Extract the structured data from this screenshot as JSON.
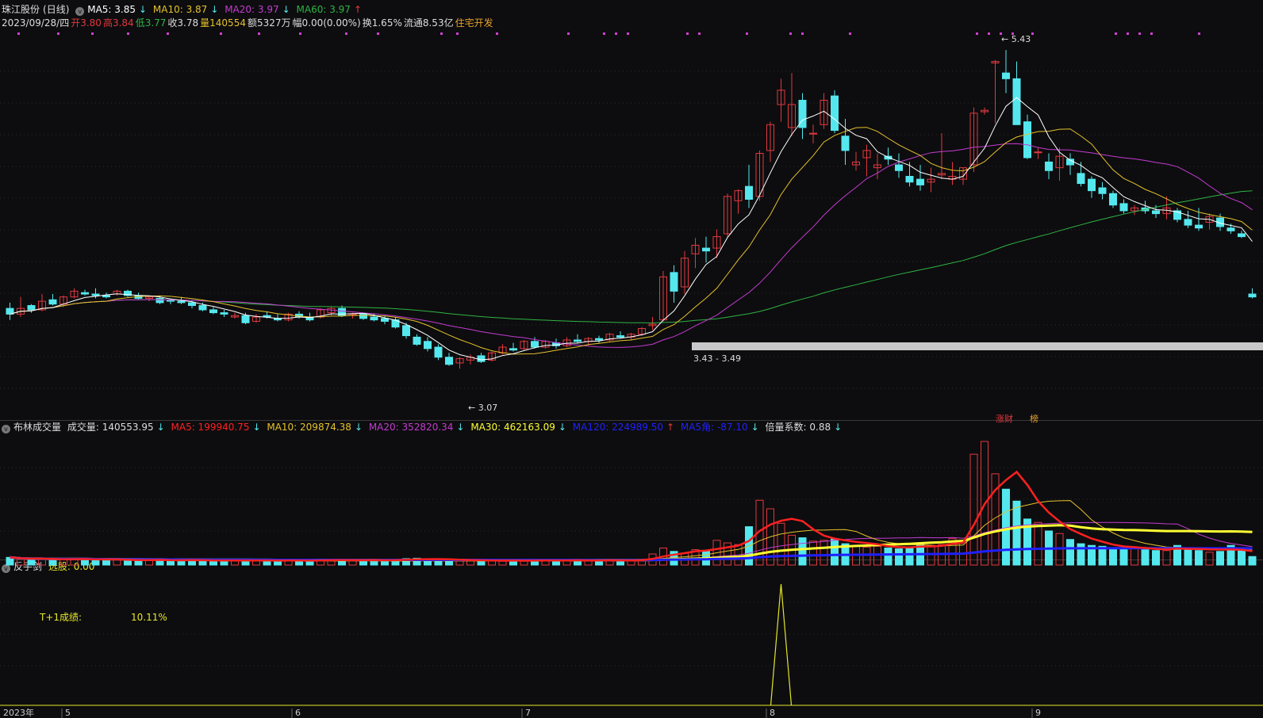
{
  "main": {
    "name": "珠江股份",
    "period": "(日线)",
    "ma5": "MA5: 3.85",
    "ma10": "MA10: 3.87",
    "ma20": "MA20: 3.97",
    "ma60": "MA60: 3.97",
    "info": {
      "date": "2023/09/28/四",
      "open": "开3.80",
      "high": "高3.84",
      "low": "低3.77",
      "close": "收3.78",
      "vol": "量140554",
      "amount": "额5327万",
      "range": "幅0.00(0.00%)",
      "turnover": "换1.65%",
      "float": "流通8.53亿",
      "industry": "住宅开发"
    },
    "labels": {
      "high": "5.43",
      "low": "3.07",
      "gap": "3.43 - 3.49"
    },
    "flags": {
      "zhangcai": "涨财",
      "bang": "榜"
    },
    "colors": {
      "up": "#e0393f",
      "down": "#54e8ee",
      "ma5": "#ffffff",
      "ma10": "#e5c12b",
      "ma20": "#c43bd0",
      "ma60": "#2fb344"
    }
  },
  "volume": {
    "name": "布林成交量",
    "vol": "成交量: 140553.95",
    "ma5": "MA5: 199940.75",
    "ma10": "MA10: 209874.38",
    "ma20": "MA20: 352820.34",
    "ma30": "MA30: 462163.09",
    "ma120": "MA120: 224989.50",
    "ma5jiao": "MA5角: -87.10",
    "factor": "倍量系数: 0.88"
  },
  "indicator": {
    "name": "反手剑",
    "pick": "选股: 0.00",
    "t1_label": "T+1成绩:",
    "t1_value": "10.11%"
  },
  "axis": {
    "year": "2023年",
    "months": [
      "5",
      "6",
      "7",
      "8",
      "9"
    ]
  },
  "chart_data": {
    "type": "candlestick",
    "title": "珠江股份 (日线)",
    "y_range": [
      2.95,
      5.6
    ],
    "candles": [
      [
        3.7,
        3.74,
        3.62,
        3.66
      ],
      [
        3.66,
        3.78,
        3.64,
        3.7
      ],
      [
        3.72,
        3.73,
        3.67,
        3.69
      ],
      [
        3.69,
        3.8,
        3.68,
        3.75
      ],
      [
        3.76,
        3.8,
        3.72,
        3.73
      ],
      [
        3.73,
        3.79,
        3.71,
        3.78
      ],
      [
        3.78,
        3.84,
        3.77,
        3.82
      ],
      [
        3.81,
        3.83,
        3.79,
        3.8
      ],
      [
        3.8,
        3.84,
        3.77,
        3.79
      ],
      [
        3.79,
        3.81,
        3.77,
        3.78
      ],
      [
        3.8,
        3.83,
        3.79,
        3.82
      ],
      [
        3.82,
        3.83,
        3.78,
        3.79
      ],
      [
        3.79,
        3.81,
        3.76,
        3.77
      ],
      [
        3.77,
        3.79,
        3.75,
        3.78
      ],
      [
        3.77,
        3.79,
        3.73,
        3.74
      ],
      [
        3.76,
        3.77,
        3.73,
        3.75
      ],
      [
        3.75,
        3.78,
        3.73,
        3.74
      ],
      [
        3.74,
        3.76,
        3.7,
        3.72
      ],
      [
        3.72,
        3.74,
        3.68,
        3.69
      ],
      [
        3.69,
        3.71,
        3.66,
        3.67
      ],
      [
        3.67,
        3.69,
        3.64,
        3.66
      ],
      [
        3.64,
        3.67,
        3.63,
        3.65
      ],
      [
        3.65,
        3.67,
        3.59,
        3.6
      ],
      [
        3.61,
        3.66,
        3.6,
        3.64
      ],
      [
        3.65,
        3.68,
        3.63,
        3.64
      ],
      [
        3.63,
        3.66,
        3.61,
        3.62
      ],
      [
        3.62,
        3.67,
        3.61,
        3.66
      ],
      [
        3.66,
        3.68,
        3.63,
        3.64
      ],
      [
        3.64,
        3.67,
        3.61,
        3.62
      ],
      [
        3.64,
        3.7,
        3.63,
        3.69
      ],
      [
        3.67,
        3.71,
        3.65,
        3.7
      ],
      [
        3.7,
        3.72,
        3.64,
        3.65
      ],
      [
        3.65,
        3.67,
        3.63,
        3.66
      ],
      [
        3.66,
        3.67,
        3.62,
        3.63
      ],
      [
        3.64,
        3.66,
        3.61,
        3.62
      ],
      [
        3.63,
        3.65,
        3.59,
        3.61
      ],
      [
        3.62,
        3.64,
        3.56,
        3.57
      ],
      [
        3.58,
        3.6,
        3.49,
        3.51
      ],
      [
        3.5,
        3.52,
        3.44,
        3.45
      ],
      [
        3.47,
        3.5,
        3.4,
        3.42
      ],
      [
        3.43,
        3.45,
        3.34,
        3.36
      ],
      [
        3.36,
        3.39,
        3.3,
        3.31
      ],
      [
        3.32,
        3.36,
        3.28,
        3.35
      ],
      [
        3.34,
        3.38,
        3.31,
        3.36
      ],
      [
        3.37,
        3.39,
        3.32,
        3.33
      ],
      [
        3.34,
        3.4,
        3.33,
        3.39
      ],
      [
        3.39,
        3.45,
        3.38,
        3.43
      ],
      [
        3.42,
        3.46,
        3.4,
        3.41
      ],
      [
        3.42,
        3.48,
        3.41,
        3.47
      ],
      [
        3.47,
        3.5,
        3.42,
        3.43
      ],
      [
        3.43,
        3.48,
        3.42,
        3.47
      ],
      [
        3.46,
        3.49,
        3.42,
        3.44
      ],
      [
        3.44,
        3.5,
        3.43,
        3.48
      ],
      [
        3.48,
        3.52,
        3.46,
        3.47
      ],
      [
        3.47,
        3.5,
        3.44,
        3.49
      ],
      [
        3.49,
        3.51,
        3.46,
        3.48
      ],
      [
        3.48,
        3.53,
        3.47,
        3.52
      ],
      [
        3.51,
        3.54,
        3.49,
        3.5
      ],
      [
        3.5,
        3.53,
        3.48,
        3.52
      ],
      [
        3.52,
        3.57,
        3.51,
        3.56
      ],
      [
        3.58,
        3.64,
        3.55,
        3.59
      ],
      [
        3.62,
        3.96,
        3.61,
        3.92
      ],
      [
        3.95,
        4.0,
        3.74,
        3.82
      ],
      [
        3.85,
        4.1,
        3.8,
        4.05
      ],
      [
        4.08,
        4.19,
        3.98,
        4.14
      ],
      [
        4.12,
        4.2,
        4.02,
        4.1
      ],
      [
        4.12,
        4.25,
        4.05,
        4.2
      ],
      [
        4.22,
        4.5,
        4.2,
        4.48
      ],
      [
        4.45,
        4.53,
        4.36,
        4.52
      ],
      [
        4.55,
        4.7,
        4.4,
        4.46
      ],
      [
        4.48,
        4.8,
        4.45,
        4.78
      ],
      [
        4.8,
        5.0,
        4.72,
        4.98
      ],
      [
        5.12,
        5.3,
        5.0,
        5.22
      ],
      [
        4.96,
        5.34,
        4.9,
        5.12
      ],
      [
        5.15,
        5.2,
        4.88,
        4.96
      ],
      [
        4.92,
        4.98,
        4.85,
        4.92
      ],
      [
        4.98,
        5.2,
        4.95,
        5.15
      ],
      [
        5.18,
        5.22,
        4.92,
        4.94
      ],
      [
        4.9,
        5.02,
        4.7,
        4.8
      ],
      [
        4.7,
        4.79,
        4.66,
        4.72
      ],
      [
        4.75,
        4.84,
        4.62,
        4.8
      ],
      [
        4.68,
        4.78,
        4.6,
        4.7
      ],
      [
        4.76,
        4.82,
        4.7,
        4.74
      ],
      [
        4.7,
        4.78,
        4.61,
        4.66
      ],
      [
        4.62,
        4.72,
        4.55,
        4.58
      ],
      [
        4.6,
        4.7,
        4.52,
        4.56
      ],
      [
        4.58,
        4.68,
        4.51,
        4.6
      ],
      [
        4.63,
        4.92,
        4.6,
        4.64
      ],
      [
        4.6,
        4.72,
        4.56,
        4.62
      ],
      [
        4.6,
        4.68,
        4.56,
        4.68
      ],
      [
        4.7,
        5.1,
        4.65,
        5.06
      ],
      [
        5.07,
        5.1,
        5.05,
        5.08
      ],
      [
        5.41,
        5.43,
        4.99,
        5.42
      ],
      [
        5.34,
        5.5,
        5.2,
        5.3
      ],
      [
        5.3,
        5.42,
        4.98,
        4.98
      ],
      [
        5.0,
        5.05,
        4.74,
        4.75
      ],
      [
        4.79,
        4.82,
        4.74,
        4.79
      ],
      [
        4.72,
        4.78,
        4.6,
        4.66
      ],
      [
        4.68,
        4.82,
        4.59,
        4.76
      ],
      [
        4.74,
        4.78,
        4.63,
        4.7
      ],
      [
        4.64,
        4.72,
        4.55,
        4.57
      ],
      [
        4.6,
        4.62,
        4.47,
        4.52
      ],
      [
        4.54,
        4.58,
        4.46,
        4.5
      ],
      [
        4.5,
        4.52,
        4.4,
        4.42
      ],
      [
        4.43,
        4.46,
        4.36,
        4.38
      ],
      [
        4.38,
        4.42,
        4.35,
        4.4
      ],
      [
        4.4,
        4.45,
        4.36,
        4.38
      ],
      [
        4.38,
        4.42,
        4.33,
        4.36
      ],
      [
        4.36,
        4.48,
        4.32,
        4.4
      ],
      [
        4.38,
        4.4,
        4.3,
        4.32
      ],
      [
        4.32,
        4.38,
        4.26,
        4.28
      ],
      [
        4.28,
        4.4,
        4.24,
        4.26
      ],
      [
        4.3,
        4.36,
        4.25,
        4.34
      ],
      [
        4.33,
        4.36,
        4.24,
        4.27
      ],
      [
        4.26,
        4.29,
        4.22,
        4.24
      ],
      [
        4.22,
        4.24,
        4.19,
        4.2
      ],
      [
        3.8,
        3.84,
        3.77,
        3.78
      ]
    ],
    "volumes": [
      18,
      14,
      13,
      15,
      12,
      14,
      16,
      13,
      11,
      12,
      14,
      11,
      10,
      12,
      13,
      11,
      10,
      12,
      11,
      10,
      11,
      10,
      12,
      11,
      10,
      9,
      11,
      12,
      10,
      11,
      13,
      12,
      11,
      10,
      12,
      11,
      13,
      15,
      16,
      14,
      12,
      11,
      10,
      12,
      11,
      10,
      9,
      11,
      10,
      12,
      11,
      10,
      11,
      12,
      10,
      11,
      12,
      10,
      11,
      13,
      26,
      40,
      32,
      28,
      36,
      34,
      58,
      52,
      48,
      90,
      152,
      132,
      98,
      70,
      64,
      56,
      58,
      62,
      50,
      46,
      42,
      44,
      40,
      38,
      42,
      52,
      46,
      48,
      62,
      54,
      260,
      290,
      214,
      178,
      150,
      108,
      100,
      80,
      74,
      60,
      50,
      46,
      44,
      40,
      38,
      42,
      36,
      34,
      34,
      46,
      40,
      34,
      30,
      32,
      46,
      36,
      20
    ]
  }
}
